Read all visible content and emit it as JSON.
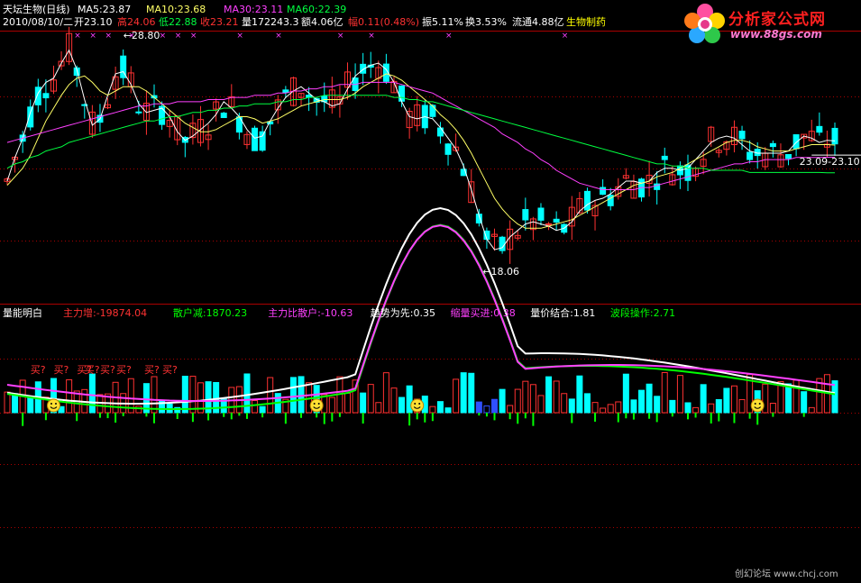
{
  "colors": {
    "up": "#ff3232",
    "down": "#00ffff",
    "ma5": "#ffffff",
    "ma10": "#ffff66",
    "ma30": "#ff40ff",
    "ma60": "#00ff40",
    "grid": "#aa0000",
    "white": "#ffffff",
    "yellow": "#ffff00",
    "magenta": "#ff40ff",
    "green": "#00ff00",
    "red": "#ff3232",
    "cyan": "#00ffff",
    "blue": "#3050ff",
    "gray": "#c0c0c0"
  },
  "header": {
    "title": "天坛生物(日线)",
    "ma5": "MA5:23.87",
    "ma10": "MA10:23.68",
    "ma30": "MA30:23.11",
    "ma60": "MA60:22.39",
    "date": "2010/08/10/二",
    "open": "开23.10",
    "high": "高24.06",
    "low": "低22.88",
    "close": "收23.21",
    "volume": "量172243.3",
    "amount": "额4.06亿",
    "change": "幅0.11(0.48%)",
    "amplitude": "振5.11%",
    "turnover": "换3.53%",
    "float": "流通4.88亿",
    "sector": "生物制药"
  },
  "logo": {
    "name": "分析家公式网",
    "url": "www.88gs.com"
  },
  "watermark": "创幻论坛 www.chcj.com",
  "chart_data": [
    {
      "type": "candlestick",
      "title": "天坛生物(日线)",
      "annotations": [
        "28.80",
        "←18.06",
        "23.09-23.10"
      ],
      "series": [
        {
          "name": "MA5",
          "values": [
            22.0,
            23.1,
            24.0,
            25.2,
            26.1,
            26.6,
            26.8,
            27.5,
            28.1,
            27.2,
            25.8,
            24.6,
            24.9,
            26.0,
            27.0,
            27.1,
            26.5,
            25.6,
            25.2,
            25.3,
            25.4,
            25.0,
            24.3,
            23.9,
            24.1,
            24.4,
            24.7,
            25.1,
            25.7,
            25.4,
            25.0,
            24.4,
            24.0,
            24.1,
            24.8,
            25.4,
            25.9,
            26.2,
            26.4,
            26.1,
            25.8,
            25.7,
            25.5,
            25.6,
            26.3,
            26.9,
            27.2,
            27.4,
            27.5,
            27.2,
            26.6,
            25.7,
            25.0,
            24.9,
            25.0,
            24.9,
            24.5,
            24.0,
            23.5,
            22.7,
            21.6,
            20.4,
            19.3,
            18.8,
            18.9,
            19.4,
            19.7,
            20.0,
            20.1,
            20.0,
            19.9,
            19.7,
            19.8,
            20.1,
            20.6,
            20.9,
            21.1,
            21.2,
            21.4,
            21.7,
            22.0,
            22.0,
            21.9,
            22.0,
            22.4,
            22.6,
            22.6,
            22.5,
            22.6,
            23.0,
            23.4,
            23.8,
            24.0,
            24.1,
            24.0,
            23.7,
            23.4,
            23.3,
            23.3,
            23.3,
            23.3,
            23.4,
            23.8,
            24.1,
            24.0,
            23.8,
            23.9,
            23.87
          ]
        },
        {
          "name": "MA10",
          "values": [
            21.8,
            22.2,
            22.6,
            23.2,
            24.0,
            24.8,
            25.4,
            26.0,
            26.5,
            26.8,
            26.9,
            26.6,
            26.2,
            26.0,
            26.2,
            26.4,
            26.4,
            26.4,
            26.2,
            25.9,
            25.6,
            25.3,
            25.0,
            24.7,
            24.5,
            24.3,
            24.3,
            24.4,
            24.6,
            24.8,
            25.0,
            25.0,
            24.9,
            24.7,
            24.8,
            24.9,
            25.1,
            25.3,
            25.5,
            25.6,
            25.7,
            25.8,
            25.8,
            25.8,
            25.9,
            26.1,
            26.4,
            26.6,
            26.8,
            27.0,
            26.9,
            26.7,
            26.4,
            26.1,
            25.8,
            25.5,
            25.1,
            24.8,
            24.4,
            23.9,
            23.3,
            22.6,
            21.9,
            21.2,
            20.7,
            20.3,
            20.0,
            19.8,
            19.8,
            19.8,
            19.9,
            20.0,
            20.1,
            20.2,
            20.4,
            20.6,
            20.8,
            21.0,
            21.2,
            21.4,
            21.6,
            21.8,
            21.9,
            22.0,
            22.2,
            22.3,
            22.4,
            22.6,
            22.8,
            23.0,
            23.2,
            23.4,
            23.6,
            23.8,
            23.9,
            23.9,
            23.8,
            23.6,
            23.5,
            23.4,
            23.4,
            23.4,
            23.5,
            23.6,
            23.7,
            23.7,
            23.7,
            23.68
          ]
        },
        {
          "name": "MA30",
          "values": [
            23.8,
            23.9,
            24.0,
            24.1,
            24.2,
            24.3,
            24.4,
            24.5,
            24.6,
            24.7,
            24.8,
            24.9,
            25.0,
            25.1,
            25.2,
            25.3,
            25.4,
            25.5,
            25.5,
            25.6,
            25.6,
            25.6,
            25.7,
            25.7,
            25.7,
            25.7,
            25.8,
            25.8,
            25.8,
            25.9,
            25.9,
            25.9,
            26.0,
            26.0,
            26.0,
            26.1,
            26.1,
            26.2,
            26.2,
            26.3,
            26.3,
            26.4,
            26.4,
            26.5,
            26.5,
            26.5,
            26.6,
            26.6,
            26.6,
            26.6,
            26.6,
            26.5,
            26.4,
            26.3,
            26.2,
            26.1,
            25.9,
            25.7,
            25.5,
            25.3,
            25.1,
            24.9,
            24.7,
            24.5,
            24.2,
            24.0,
            23.8,
            23.5,
            23.3,
            23.0,
            22.8,
            22.5,
            22.3,
            22.1,
            21.9,
            21.8,
            21.7,
            21.6,
            21.6,
            21.6,
            21.6,
            21.6,
            21.7,
            21.7,
            21.8,
            21.9,
            22.0,
            22.1,
            22.2,
            22.3,
            22.4,
            22.5,
            22.6,
            22.7,
            22.8,
            22.8,
            22.9,
            22.9,
            23.0,
            23.0,
            23.0,
            23.0,
            23.1,
            23.1,
            23.1,
            23.1,
            23.11,
            23.11
          ]
        },
        {
          "name": "MA60",
          "values": [
            22.6,
            22.8,
            22.9,
            23.1,
            23.2,
            23.4,
            23.5,
            23.6,
            23.8,
            23.9,
            24.0,
            24.1,
            24.2,
            24.3,
            24.4,
            24.5,
            24.6,
            24.7,
            24.8,
            24.8,
            24.9,
            25.0,
            25.0,
            25.1,
            25.2,
            25.2,
            25.3,
            25.3,
            25.4,
            25.4,
            25.5,
            25.5,
            25.6,
            25.6,
            25.6,
            25.7,
            25.7,
            25.8,
            25.8,
            25.9,
            25.9,
            26.0,
            26.0,
            26.0,
            26.0,
            26.0,
            26.0,
            26.0,
            26.0,
            26.0,
            25.9,
            25.9,
            25.8,
            25.8,
            25.7,
            25.7,
            25.6,
            25.5,
            25.4,
            25.3,
            25.2,
            25.1,
            25.0,
            24.9,
            24.8,
            24.7,
            24.6,
            24.5,
            24.4,
            24.3,
            24.2,
            24.1,
            24.0,
            23.9,
            23.8,
            23.7,
            23.6,
            23.5,
            23.4,
            23.3,
            23.2,
            23.1,
            23.0,
            22.9,
            22.8,
            22.8,
            22.7,
            22.7,
            22.6,
            22.6,
            22.6,
            22.5,
            22.5,
            22.5,
            22.5,
            22.5,
            22.4,
            22.4,
            22.4,
            22.4,
            22.4,
            22.4,
            22.4,
            22.4,
            22.4,
            22.4,
            22.39,
            22.39
          ]
        }
      ]
    },
    {
      "type": "bar",
      "title": "量能明白",
      "legend": [
        {
          "label": "主力增",
          "value": "-19874.04",
          "color": "#ff3232"
        },
        {
          "label": "散户减",
          "value": "1870.23",
          "color": "#00ff00"
        },
        {
          "label": "主力比散户",
          "value": "-10.63",
          "color": "#ff40ff"
        },
        {
          "label": "趋势为先",
          "value": "0.35",
          "color": "#ffffff"
        },
        {
          "label": "缩量买进",
          "value": "0.38",
          "color": "#ff40ff"
        },
        {
          "label": "量价结合",
          "value": "1.81",
          "color": "#ffffff"
        },
        {
          "label": "波段操作",
          "value": "2.71",
          "color": "#00ff00"
        }
      ],
      "signal_label": "买?",
      "buy_signals": [
        23,
        52,
        84,
        92,
        104,
        129,
        160,
        180
      ],
      "smiley_signals": [
        6,
        40,
        97,
        161
      ]
    }
  ]
}
